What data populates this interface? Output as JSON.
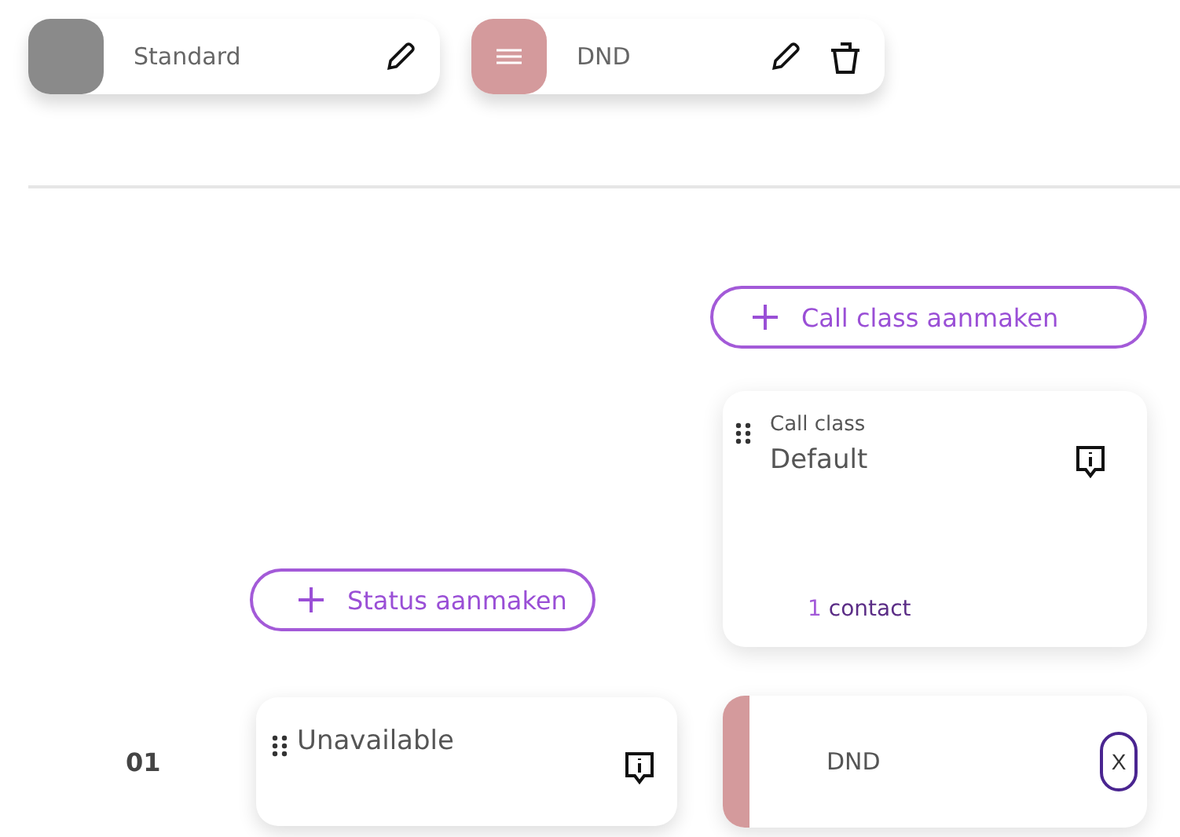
{
  "presets": [
    {
      "name": "Standard",
      "color": "#8a8a8a",
      "kind": "plain",
      "deletable": false
    },
    {
      "name": "DND",
      "color": "#d49a9c",
      "kind": "menu",
      "deletable": true
    }
  ],
  "add_call_class": {
    "label": "Call class aanmaken"
  },
  "call_class_card": {
    "caption": "Call class",
    "name": "Default",
    "count": "1",
    "count_label": "contact"
  },
  "add_status": {
    "label": "Status aanmaken"
  },
  "rows": [
    {
      "number": "01",
      "status": "Unavailable",
      "assignment": {
        "name": "DND",
        "color": "#d49a9c",
        "remove": "X"
      }
    }
  ]
}
